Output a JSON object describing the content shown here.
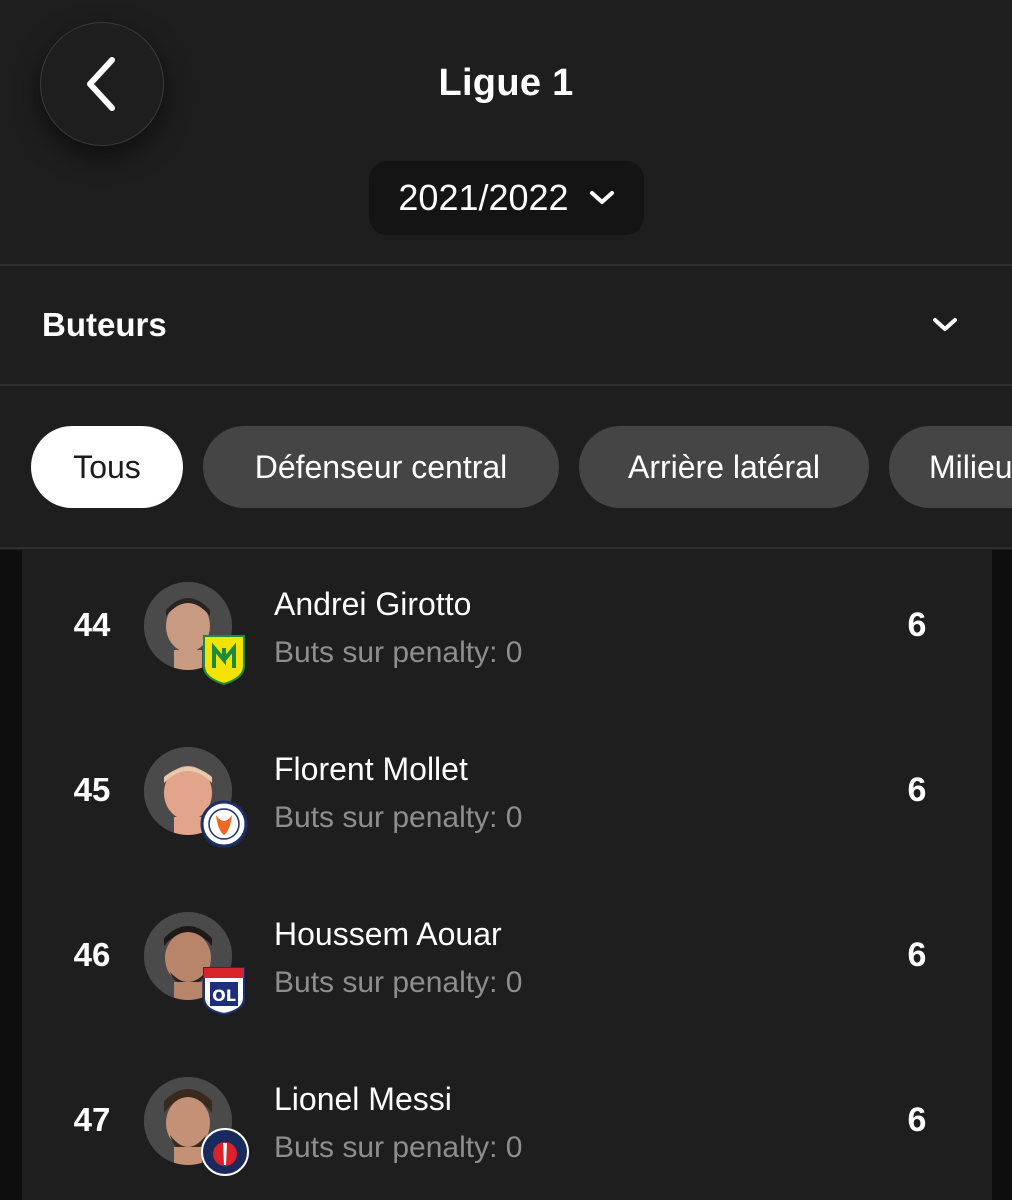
{
  "header": {
    "title": "Ligue 1",
    "season": "2021/2022"
  },
  "category": {
    "label": "Buteurs"
  },
  "filters": [
    {
      "label": "Tous",
      "active": true
    },
    {
      "label": "Défenseur central",
      "active": false
    },
    {
      "label": "Arrière latéral",
      "active": false
    },
    {
      "label": "Milieu",
      "active": false
    }
  ],
  "players": [
    {
      "rank": "44",
      "name": "Andrei Girotto",
      "penalty": "Buts sur penalty: 0",
      "goals": "6",
      "club_badge": "nantes-badge",
      "badge_text": "FC NANTES"
    },
    {
      "rank": "45",
      "name": "Florent Mollet",
      "penalty": "Buts sur penalty: 0",
      "goals": "6",
      "club_badge": "montpellier-badge",
      "badge_text": "MONTPELLIER HÉRAULT SPORT CLUB 1974"
    },
    {
      "rank": "46",
      "name": "Houssem Aouar",
      "penalty": "Buts sur penalty: 0",
      "goals": "6",
      "club_badge": "lyon-badge",
      "badge_text": "OLYMPIQUE LYONNAIS"
    },
    {
      "rank": "47",
      "name": "Lionel Messi",
      "penalty": "Buts sur penalty: 0",
      "goals": "6",
      "club_badge": "psg-badge",
      "badge_text": "PARIS"
    }
  ],
  "colors": {
    "background": "#1e1e1e",
    "chip": "#454545",
    "chip_active": "#ffffff",
    "secondary_text": "#8e8e8e"
  }
}
